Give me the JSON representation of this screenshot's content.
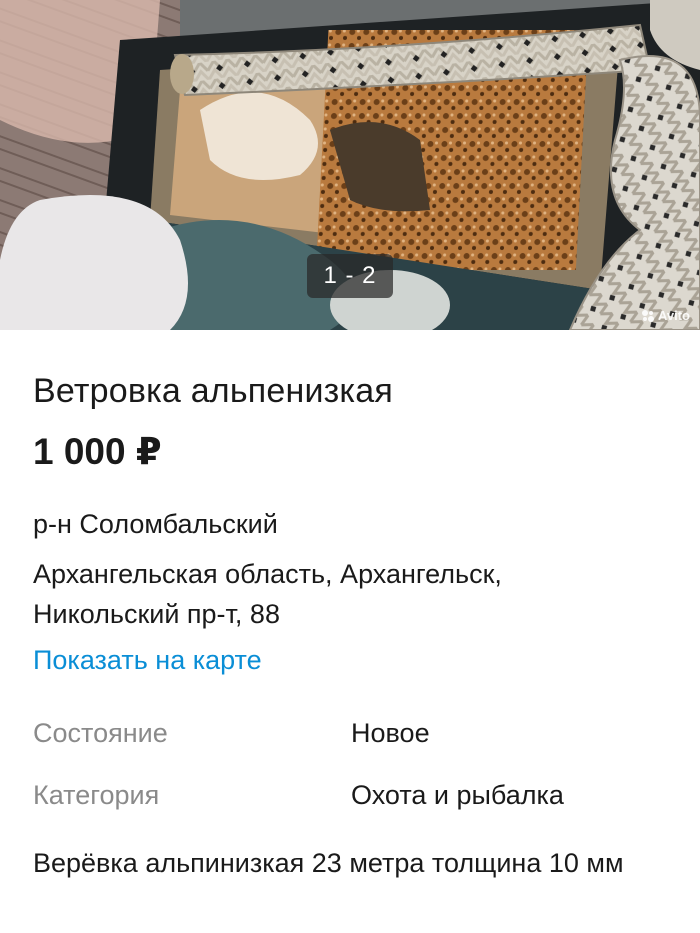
{
  "gallery": {
    "counter": "1 - 2",
    "watermark": "Avito"
  },
  "listing": {
    "title": "Ветровка альпенизкая",
    "price": "1 000 ₽",
    "district": "р-н Соломбальский",
    "address": "Архангельская область, Архангельск, Никольский пр-т, 88",
    "map_link": "Показать на карте"
  },
  "params": [
    {
      "label": "Состояние",
      "value": "Новое"
    },
    {
      "label": "Категория",
      "value": "Охота и рыбалка"
    }
  ],
  "description": "Верёвка альпинизкая 23 метра толщина 10 мм",
  "colors": {
    "link": "#0a8ed6",
    "muted_label": "#8a8a8a",
    "text": "#1a1a1a"
  }
}
